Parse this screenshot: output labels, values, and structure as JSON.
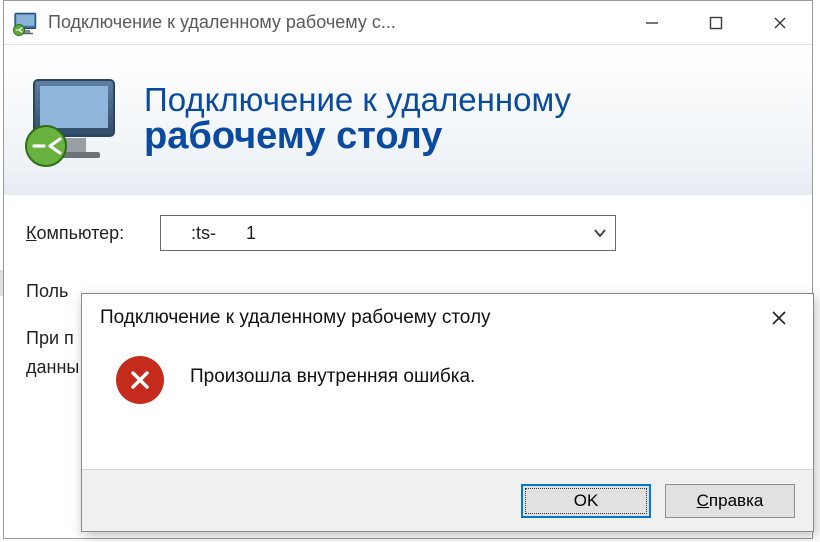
{
  "titlebar": {
    "title": "Подключение к удаленному рабочему с..."
  },
  "banner": {
    "line1": "Подключение к удаленному",
    "line2": "рабочему столу"
  },
  "form": {
    "computer_label_pre": "К",
    "computer_label_rest": "омпьютер:",
    "computer_value": ":ts-      1",
    "user_label": "Поль",
    "hint_line1": "При п",
    "hint_line2": "данны"
  },
  "modal": {
    "title": "Подключение к удаленному рабочему столу",
    "message": "Произошла внутренняя ошибка.",
    "ok_label": "OK",
    "help_pre": "С",
    "help_rest": "правка"
  }
}
